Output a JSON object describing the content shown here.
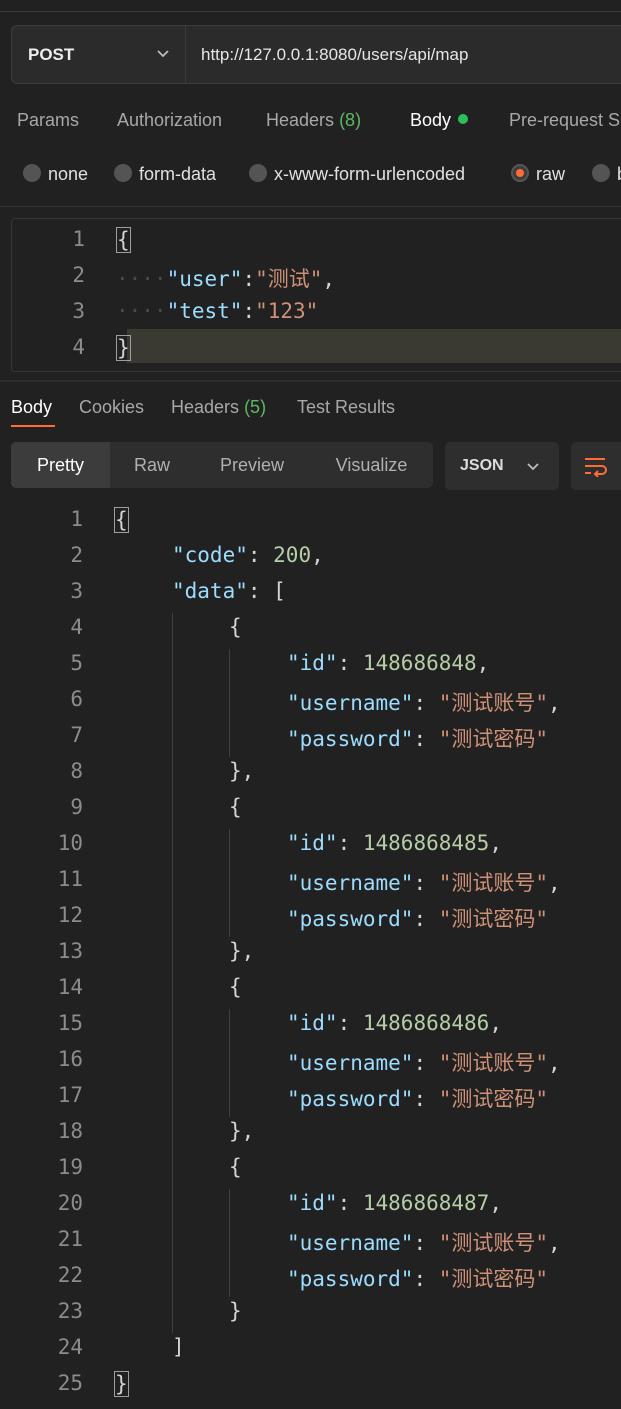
{
  "request": {
    "method": "POST",
    "url": "http://127.0.0.1:8080/users/api/map"
  },
  "request_tabs": {
    "params": "Params",
    "authorization": "Authorization",
    "headers": "Headers",
    "headers_count": "(8)",
    "body": "Body",
    "prerequest": "Pre-request S"
  },
  "body_types": {
    "none": "none",
    "form_data": "form-data",
    "urlencoded": "x-www-form-urlencoded",
    "raw": "raw",
    "binary": "b",
    "selected": "raw"
  },
  "request_body": {
    "line_numbers": [
      "1",
      "2",
      "3",
      "4"
    ],
    "open": "{",
    "close": "}",
    "user_key": "\"user\"",
    "user_val": "\"测试\"",
    "test_key": "\"test\"",
    "test_val": "\"123\""
  },
  "response_tabs": {
    "body": "Body",
    "cookies": "Cookies",
    "headers": "Headers",
    "headers_count": "(5)",
    "test_results": "Test Results"
  },
  "view_modes": {
    "pretty": "Pretty",
    "raw": "Raw",
    "preview": "Preview",
    "visualize": "Visualize",
    "selected": "Pretty"
  },
  "format_select": "JSON",
  "icons": {
    "method_dropdown": "chevron-down-icon",
    "format_dropdown": "chevron-down-icon",
    "wrap": "wrap-lines-icon"
  },
  "colors": {
    "accent": "#ff6c37",
    "status_dot": "#2ebd5b",
    "count": "#5fb85f"
  },
  "response_body": {
    "code_key": "\"code\"",
    "code_val": "200",
    "data_key": "\"data\"",
    "items": [
      {
        "id": "148686848",
        "username": "\"测试账号\"",
        "password": "\"测试密码\""
      },
      {
        "id": "1486868485",
        "username": "\"测试账号\"",
        "password": "\"测试密码\""
      },
      {
        "id": "1486868486",
        "username": "\"测试账号\"",
        "password": "\"测试密码\""
      },
      {
        "id": "1486868487",
        "username": "\"测试账号\"",
        "password": "\"测试密码\""
      }
    ],
    "id_key": "\"id\"",
    "username_key": "\"username\"",
    "password_key": "\"password\"",
    "line_numbers": [
      "1",
      "2",
      "3",
      "4",
      "5",
      "6",
      "7",
      "8",
      "9",
      "10",
      "11",
      "12",
      "13",
      "14",
      "15",
      "16",
      "17",
      "18",
      "19",
      "20",
      "21",
      "22",
      "23",
      "24",
      "25"
    ]
  }
}
